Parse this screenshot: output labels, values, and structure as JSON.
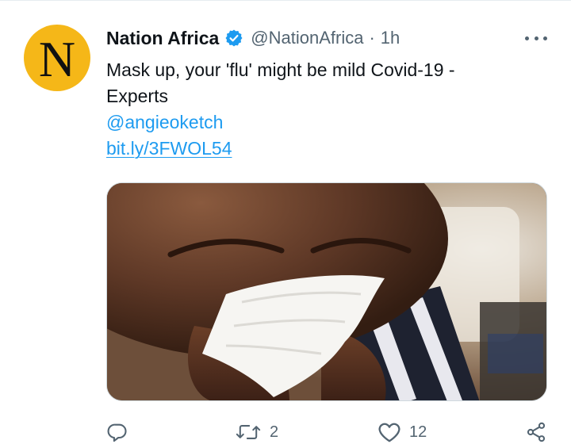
{
  "tweet": {
    "author": {
      "avatar_letter": "N",
      "display_name": "Nation Africa",
      "handle": "@NationAfrica",
      "separator": "·",
      "time": "1h",
      "verified": true
    },
    "text_lines": [
      "Mask up, your 'flu' might be mild Covid-19 -",
      "Experts"
    ],
    "mention": "@angieoketch",
    "link": "bit.ly/3FWOL54",
    "media": {
      "kind": "photo",
      "subject": "person sneezing into a tissue"
    },
    "actions": {
      "reply": {
        "icon": "reply-icon",
        "count": ""
      },
      "retweet": {
        "icon": "retweet-icon",
        "count": "2"
      },
      "like": {
        "icon": "heart-icon",
        "count": "12"
      },
      "share": {
        "icon": "share-icon",
        "count": ""
      }
    }
  },
  "colors": {
    "accent": "#1d9bf0",
    "text": "#0f1419",
    "muted": "#536471",
    "avatar_bg": "#f5b718"
  }
}
